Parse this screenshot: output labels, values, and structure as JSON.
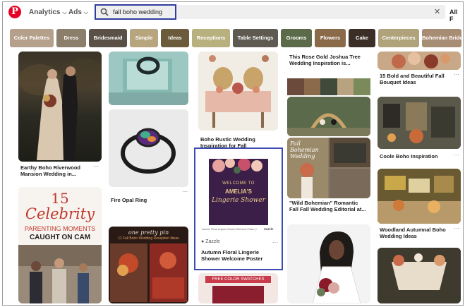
{
  "topbar": {
    "analytics_label": "Analytics",
    "ads_label": "Ads",
    "search_value": "fall boho wedding",
    "clear_glyph": "✕",
    "all_filters_label": "All F"
  },
  "chips": [
    {
      "label": "Color Palettes",
      "color": "#b5a08c"
    },
    {
      "label": "Dress",
      "color": "#8b7e6a"
    },
    {
      "label": "Bridesmaid",
      "color": "#5a5046"
    },
    {
      "label": "Simple",
      "color": "#b7a57e"
    },
    {
      "label": "Ideas",
      "color": "#6b5b3a"
    },
    {
      "label": "Receptions",
      "color": "#b8b07e"
    },
    {
      "label": "Table Settings",
      "color": "#5e5a52"
    },
    {
      "label": "Grooms",
      "color": "#5b6b4a"
    },
    {
      "label": "Flowers",
      "color": "#8b6a4a"
    },
    {
      "label": "Cake",
      "color": "#3a2e26"
    },
    {
      "label": "Centerpieces",
      "color": "#b0a27a"
    },
    {
      "label": "Bohemian Bride",
      "color": "#a88d75"
    }
  ],
  "pins": {
    "earthy": {
      "caption": "Earthy Boho Riverwood Mansion Wedding in..."
    },
    "celebrity": {
      "line1": "15",
      "line2": "Celebrity",
      "line3": "PARENTING MOMENTS",
      "line4": "CAUGHT ON CAM"
    },
    "fire_opal": {
      "caption": "Fire Opal Ring"
    },
    "rustic": {
      "caption": "Boho Rustic Wedding Inspiration for Fall"
    },
    "poster": {
      "card_line1": "WELCOME TO",
      "card_line2": "AMELIA'S",
      "card_line3": "Lingerie Shower",
      "brand": "Zazzle",
      "caption": "Autumn Floral Lingerie Shower Welcome Poster",
      "fine_print": "Autumn Floral Lingerie Shower Welcome Poster | by FloralRoyalty",
      "fine_brand": "Zazzle"
    },
    "rose_gold": {
      "caption": "This Rose Gold Joshua Tree Wedding Inspiration is..."
    },
    "wild_bohemian": {
      "caption": "\"Wild Bohemian\" Romantic Fall Fall Wedding Editorial at...",
      "overlay": "Fall Bohemian Wedding"
    },
    "bouquet": {
      "caption": "15 Bold and Beautiful Fall Bouquet Ideas"
    },
    "coole": {
      "caption": "Coole Boho Inspiration"
    },
    "woodland": {
      "caption": "Woodland Autumnal Boho Wedding Ideas"
    },
    "one_pretty": {
      "line1": "one pretty pin",
      "line2": "11 Fall Boho Wedding Reception Ideas"
    },
    "swatches": {
      "label": "FREE COLOR SWATCHES"
    }
  },
  "palette_swatches": [
    "#6b4a3c",
    "#8a6a4a",
    "#3f4a3a",
    "#b9a280",
    "#7b8a5a"
  ],
  "dots": "···"
}
